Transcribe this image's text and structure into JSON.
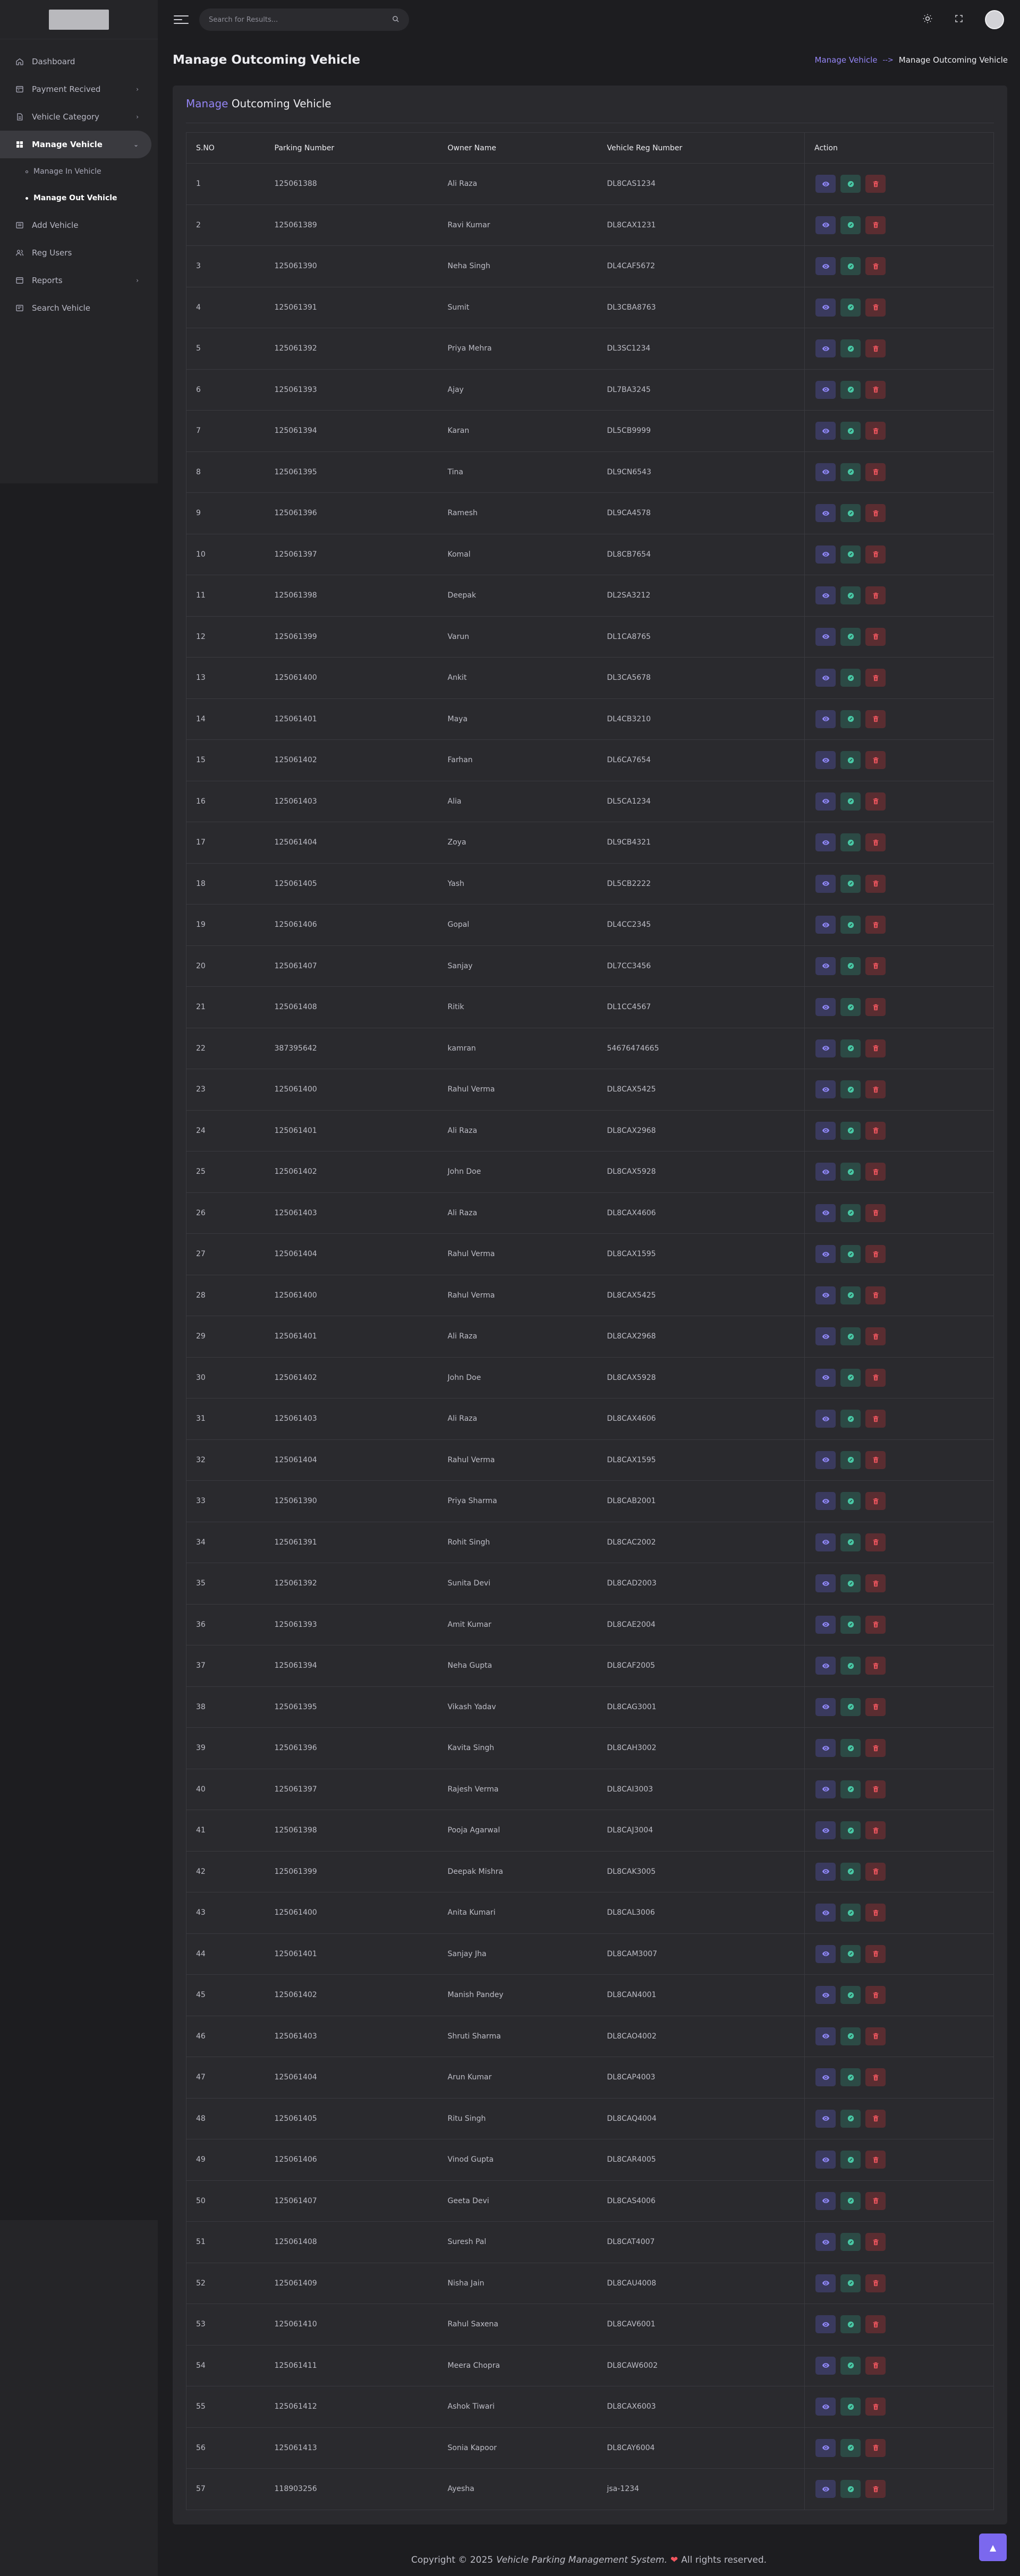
{
  "header": {
    "search_placeholder": "Search for Results..."
  },
  "sidebar": {
    "items": [
      {
        "label": "Dashboard",
        "icon": "home-icon"
      },
      {
        "label": "Payment Recived",
        "icon": "payment-icon"
      },
      {
        "label": "Vehicle Category",
        "icon": "document-icon"
      },
      {
        "label": "Manage Vehicle",
        "icon": "grid-icon"
      },
      {
        "label": "Add Vehicle",
        "icon": "list-icon"
      },
      {
        "label": "Reg Users",
        "icon": "users-icon"
      },
      {
        "label": "Reports",
        "icon": "reports-icon"
      },
      {
        "label": "Search Vehicle",
        "icon": "search-list-icon"
      }
    ],
    "sub_items": [
      {
        "label": "Manage In Vehicle"
      },
      {
        "label": "Manage Out Vehicle"
      }
    ]
  },
  "page": {
    "title": "Manage Outcoming Vehicle",
    "breadcrumb_link": "Manage Vehicle",
    "breadcrumb_sep": "-->",
    "breadcrumb_current": "Manage Outcoming Vehicle"
  },
  "card": {
    "title_highlight": "Manage",
    "title_rest": "Outcoming Vehicle"
  },
  "table": {
    "headers": [
      "S.NO",
      "Parking Number",
      "Owner Name",
      "Vehicle Reg Number",
      "Action"
    ],
    "rows": [
      [
        "1",
        "125061388",
        "Ali Raza",
        "DL8CAS1234"
      ],
      [
        "2",
        "125061389",
        "Ravi Kumar",
        "DL8CAX1231"
      ],
      [
        "3",
        "125061390",
        "Neha Singh",
        "DL4CAF5672"
      ],
      [
        "4",
        "125061391",
        "Sumit",
        "DL3CBA8763"
      ],
      [
        "5",
        "125061392",
        "Priya Mehra",
        "DL3SC1234"
      ],
      [
        "6",
        "125061393",
        "Ajay",
        "DL7BA3245"
      ],
      [
        "7",
        "125061394",
        "Karan",
        "DL5CB9999"
      ],
      [
        "8",
        "125061395",
        "Tina",
        "DL9CN6543"
      ],
      [
        "9",
        "125061396",
        "Ramesh",
        "DL9CA4578"
      ],
      [
        "10",
        "125061397",
        "Komal",
        "DL8CB7654"
      ],
      [
        "11",
        "125061398",
        "Deepak",
        "DL2SA3212"
      ],
      [
        "12",
        "125061399",
        "Varun",
        "DL1CA8765"
      ],
      [
        "13",
        "125061400",
        "Ankit",
        "DL3CA5678"
      ],
      [
        "14",
        "125061401",
        "Maya",
        "DL4CB3210"
      ],
      [
        "15",
        "125061402",
        "Farhan",
        "DL6CA7654"
      ],
      [
        "16",
        "125061403",
        "Alia",
        "DL5CA1234"
      ],
      [
        "17",
        "125061404",
        "Zoya",
        "DL9CB4321"
      ],
      [
        "18",
        "125061405",
        "Yash",
        "DL5CB2222"
      ],
      [
        "19",
        "125061406",
        "Gopal",
        "DL4CC2345"
      ],
      [
        "20",
        "125061407",
        "Sanjay",
        "DL7CC3456"
      ],
      [
        "21",
        "125061408",
        "Ritik",
        "DL1CC4567"
      ],
      [
        "22",
        "387395642",
        "kamran",
        "54676474665"
      ],
      [
        "23",
        "125061400",
        "Rahul Verma",
        "DL8CAX5425"
      ],
      [
        "24",
        "125061401",
        "Ali Raza",
        "DL8CAX2968"
      ],
      [
        "25",
        "125061402",
        "John Doe",
        "DL8CAX5928"
      ],
      [
        "26",
        "125061403",
        "Ali Raza",
        "DL8CAX4606"
      ],
      [
        "27",
        "125061404",
        "Rahul Verma",
        "DL8CAX1595"
      ],
      [
        "28",
        "125061400",
        "Rahul Verma",
        "DL8CAX5425"
      ],
      [
        "29",
        "125061401",
        "Ali Raza",
        "DL8CAX2968"
      ],
      [
        "30",
        "125061402",
        "John Doe",
        "DL8CAX5928"
      ],
      [
        "31",
        "125061403",
        "Ali Raza",
        "DL8CAX4606"
      ],
      [
        "32",
        "125061404",
        "Rahul Verma",
        "DL8CAX1595"
      ],
      [
        "33",
        "125061390",
        "Priya Sharma",
        "DL8CAB2001"
      ],
      [
        "34",
        "125061391",
        "Rohit Singh",
        "DL8CAC2002"
      ],
      [
        "35",
        "125061392",
        "Sunita Devi",
        "DL8CAD2003"
      ],
      [
        "36",
        "125061393",
        "Amit Kumar",
        "DL8CAE2004"
      ],
      [
        "37",
        "125061394",
        "Neha Gupta",
        "DL8CAF2005"
      ],
      [
        "38",
        "125061395",
        "Vikash Yadav",
        "DL8CAG3001"
      ],
      [
        "39",
        "125061396",
        "Kavita Singh",
        "DL8CAH3002"
      ],
      [
        "40",
        "125061397",
        "Rajesh Verma",
        "DL8CAI3003"
      ],
      [
        "41",
        "125061398",
        "Pooja Agarwal",
        "DL8CAJ3004"
      ],
      [
        "42",
        "125061399",
        "Deepak Mishra",
        "DL8CAK3005"
      ],
      [
        "43",
        "125061400",
        "Anita Kumari",
        "DL8CAL3006"
      ],
      [
        "44",
        "125061401",
        "Sanjay Jha",
        "DL8CAM3007"
      ],
      [
        "45",
        "125061402",
        "Manish Pandey",
        "DL8CAN4001"
      ],
      [
        "46",
        "125061403",
        "Shruti Sharma",
        "DL8CAO4002"
      ],
      [
        "47",
        "125061404",
        "Arun Kumar",
        "DL8CAP4003"
      ],
      [
        "48",
        "125061405",
        "Ritu Singh",
        "DL8CAQ4004"
      ],
      [
        "49",
        "125061406",
        "Vinod Gupta",
        "DL8CAR4005"
      ],
      [
        "50",
        "125061407",
        "Geeta Devi",
        "DL8CAS4006"
      ],
      [
        "51",
        "125061408",
        "Suresh Pal",
        "DL8CAT4007"
      ],
      [
        "52",
        "125061409",
        "Nisha Jain",
        "DL8CAU4008"
      ],
      [
        "53",
        "125061410",
        "Rahul Saxena",
        "DL8CAV6001"
      ],
      [
        "54",
        "125061411",
        "Meera Chopra",
        "DL8CAW6002"
      ],
      [
        "55",
        "125061412",
        "Ashok Tiwari",
        "DL8CAX6003"
      ],
      [
        "56",
        "125061413",
        "Sonia Kapoor",
        "DL8CAY6004"
      ],
      [
        "57",
        "118903256",
        "Ayesha",
        "jsa-1234"
      ]
    ]
  },
  "footer": {
    "prefix": "Copyright © 2025",
    "system_name": "Vehicle Parking Management System.",
    "suffix": "All rights reserved."
  },
  "colors": {
    "accent": "#7b68ee",
    "view": "#8f87f7",
    "edit": "#48c9a5",
    "delete": "#f2565f"
  }
}
